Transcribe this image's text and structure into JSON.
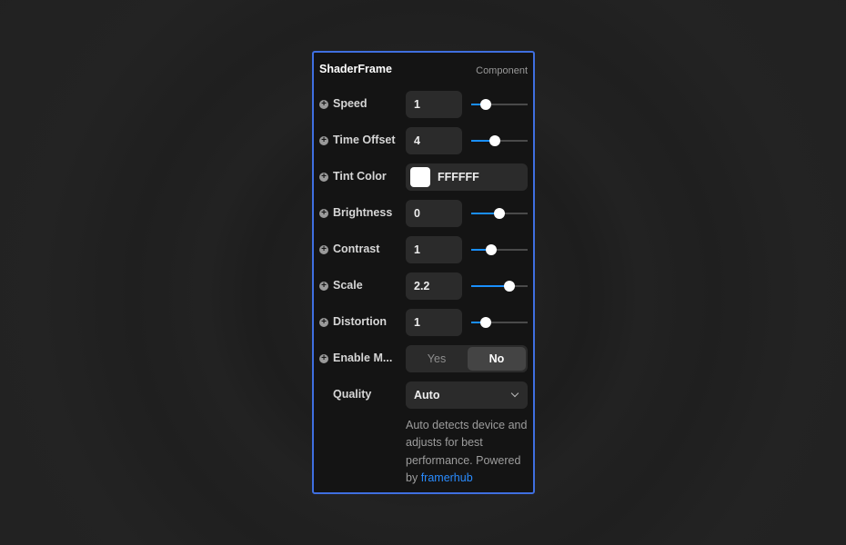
{
  "panel": {
    "title": "ShaderFrame",
    "subtitle": "Component"
  },
  "controls": [
    {
      "label": "Speed",
      "value": "1",
      "slider_fraction": 0.25
    },
    {
      "label": "Time Offset",
      "value": "4",
      "slider_fraction": 0.42
    },
    {
      "label": "Tint Color",
      "color_hex_text": "FFFFFF",
      "color": "#FFFFFF"
    },
    {
      "label": "Brightness",
      "value": "0",
      "slider_fraction": 0.5
    },
    {
      "label": "Contrast",
      "value": "1",
      "slider_fraction": 0.36
    },
    {
      "label": "Scale",
      "value": "2.2",
      "slider_fraction": 0.68
    },
    {
      "label": "Distortion",
      "value": "1",
      "slider_fraction": 0.25
    },
    {
      "label": "Enable M...",
      "options": [
        "Yes",
        "No"
      ],
      "selected": "No"
    },
    {
      "label": "Quality",
      "selected": "Auto"
    }
  ],
  "description": {
    "text": "Auto detects device and adjusts for best performance. Powered by",
    "link": "framerhub"
  },
  "colors": {
    "accent": "#1a8fff",
    "panel_border": "#3f6fe0",
    "panel_bg": "#141414"
  }
}
